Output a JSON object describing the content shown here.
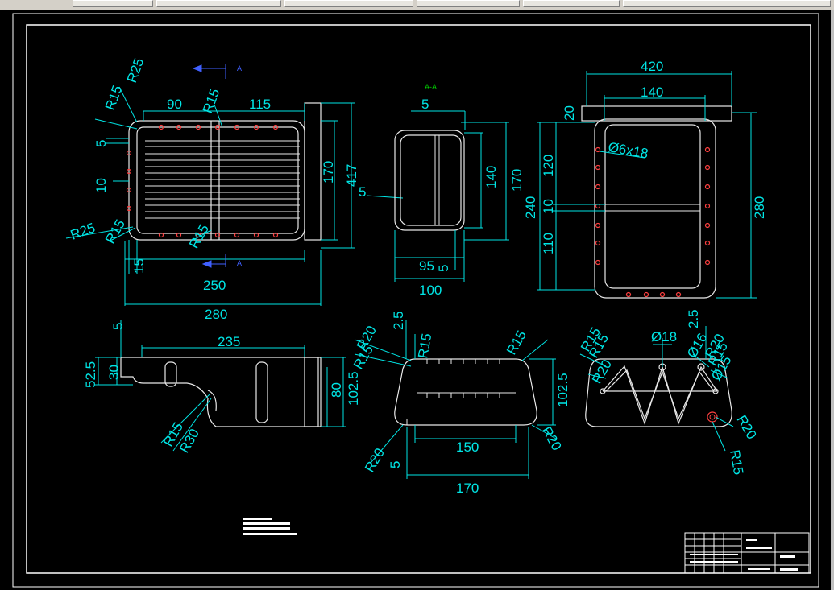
{
  "taskbar": {
    "items": [
      "",
      "",
      "",
      "",
      "",
      "",
      ""
    ]
  },
  "section_label": "A-A",
  "section_marks": [
    "A",
    "A"
  ],
  "dims": {
    "top_view": {
      "r25_top": "R25",
      "r15_top": "R15",
      "d90": "90",
      "r15_mid": "R15",
      "d115": "115",
      "d5": "5",
      "d10": "10",
      "d170": "170",
      "d417": "417",
      "r25_bottom": "R25",
      "r15_bottom": "R15",
      "r15_bottom_mid": "R15",
      "d15": "15",
      "d250": "250",
      "d280": "280",
      "d5_arrow": "5"
    },
    "section_view": {
      "d5": "5",
      "d140": "140",
      "d170": "170",
      "d95": "95",
      "d5_small": "5",
      "d100": "100"
    },
    "side_view": {
      "d420": "420",
      "d140": "140",
      "d20": "20",
      "hole_note": "Ø6x18",
      "d120": "120",
      "d240": "240",
      "d10": "10",
      "d110": "110",
      "d280": "280"
    },
    "front_view": {
      "d5": "5",
      "d235": "235",
      "d52_5": "52.5",
      "d30": "30",
      "d80": "80",
      "d102_5": "102.5",
      "r15": "R15",
      "r30": "R30"
    },
    "end_view": {
      "d2_5": "2.5",
      "r20_top": "R20",
      "r15_top": "R15",
      "r15_left": "R15",
      "r15_right": "R15",
      "d102_5": "102.5",
      "r20_bottom_left": "R20",
      "d5": "5",
      "d150": "150",
      "r20_bottom_right": "R20",
      "d170": "170"
    },
    "rib_view": {
      "r15_a": "R15",
      "r15_b": "R15",
      "d18": "Ø18",
      "d2_5": "2.5",
      "d16": "Ø16",
      "r20_a": "R20",
      "r20_b": "R20",
      "r15_c": "R15",
      "d15": "Ø15",
      "r20_c": "R20",
      "r15_d": "R15"
    }
  },
  "title_block": {
    "line1": "",
    "line2": "",
    "line3": ""
  }
}
